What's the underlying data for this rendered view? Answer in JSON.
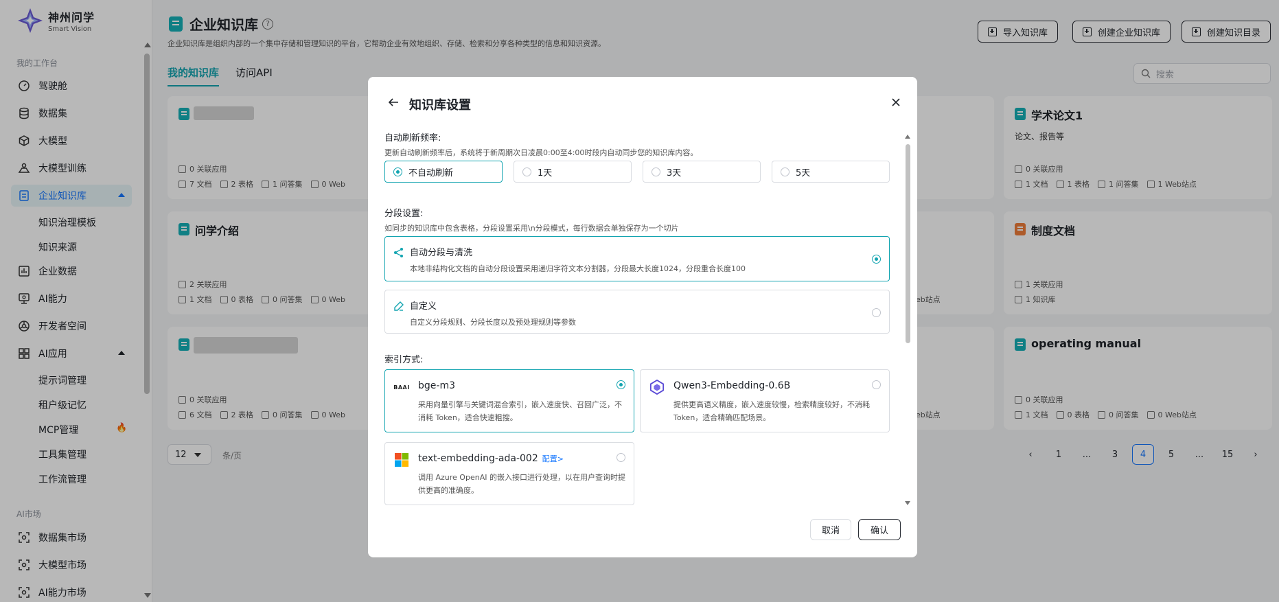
{
  "brand": {
    "name_cn": "神州问学",
    "name_en": "Smart Vision"
  },
  "sidebar": {
    "section_workbench": "我的工作台",
    "section_market": "AI市场",
    "items": [
      {
        "label": "驾驶舱",
        "icon": "dashboard-icon"
      },
      {
        "label": "数据集",
        "icon": "database-icon"
      },
      {
        "label": "大模型",
        "icon": "cube-icon"
      },
      {
        "label": "大模型训练",
        "icon": "training-icon"
      },
      {
        "label": "企业知识库",
        "icon": "knowledge-base-icon"
      },
      {
        "label": "企业数据",
        "icon": "bar-chart-icon"
      },
      {
        "label": "AI能力",
        "icon": "monitor-icon"
      },
      {
        "label": "开发者空间",
        "icon": "developer-icon"
      },
      {
        "label": "AI应用",
        "icon": "apps-grid-icon"
      },
      {
        "label": "数据集市场",
        "icon": "scan-icon"
      },
      {
        "label": "大模型市场",
        "icon": "scan-icon"
      },
      {
        "label": "AI能力市场",
        "icon": "scan-icon"
      }
    ],
    "kb_sub": [
      "知识治理模板",
      "知识来源"
    ],
    "app_sub": [
      "提示词管理",
      "租户级记忆",
      "MCP管理",
      "工具集管理",
      "工作流管理"
    ]
  },
  "header": {
    "title": "企业知识库",
    "desc": "企业知识库是组织内部的一个集中存储和管理知识的平台，它帮助企业有效地组织、存储、检索和分享各种类型的信息和知识资源。",
    "btn_import": "导入知识库",
    "btn_create": "创建企业知识库",
    "btn_catalog": "创建知识目录"
  },
  "tabs": [
    "我的知识库",
    "访问API"
  ],
  "search": {
    "placeholder": "搜索"
  },
  "cards": [
    {
      "title": "",
      "desc": "",
      "meta1": "0 关联应用",
      "docs": "7 文档",
      "tables": "2 表格",
      "qa": "1 问答集",
      "web": "0 Web"
    },
    {
      "title": "学术论文1",
      "desc": "论文、报告等",
      "meta1": "0 关联应用",
      "docs": "1 文档",
      "tables": "1 表格",
      "qa": "1 问答集",
      "web": "1 Web站点"
    },
    {
      "title": "问学介绍",
      "desc": "",
      "meta1": "2 关联应用",
      "docs": "1 文档",
      "tables": "0 表格",
      "qa": "0 问答集",
      "web": "0 Web"
    },
    {
      "title": "制度文档",
      "desc": "",
      "meta1": "1 关联应用",
      "kb": "1 知识库"
    },
    {
      "title": "",
      "desc": "",
      "meta1": "0 关联应用",
      "docs": "6 文档",
      "tables": "2 表格",
      "qa": "0 问答集",
      "web": "0 Web"
    },
    {
      "title": "operating manual",
      "desc": "",
      "meta1": "0 关联应用",
      "docs": "1 文档",
      "tables": "0 表格",
      "qa": "0 问答集",
      "web": "0 Web站点"
    }
  ],
  "partial_web": "eb站点",
  "pager": {
    "size": "12",
    "unit": "条/页",
    "pages": [
      "1",
      "...",
      "3",
      "4",
      "5",
      "...",
      "15"
    ],
    "current": "4"
  },
  "modal": {
    "title": "知识库设置",
    "freq_label": "自动刷新频率:",
    "freq_hint": "更新自动刷新频率后，系统将于新周期次日凌晨0:00至4:00时段内自动同步您的知识库内容。",
    "freq_options": [
      "不自动刷新",
      "1天",
      "3天",
      "5天"
    ],
    "freq_selected": "不自动刷新",
    "seg_label": "分段设置:",
    "seg_hint": "如同步的知识库中包含表格，分段设置采用\\n分段模式，每行数据会单独保存为一个切片",
    "seg_auto_title": "自动分段与清洗",
    "seg_auto_desc": "本地非结构化文档的自动分段设置采用递归字符文本分割器，分段最大长度1024，分段重合长度100",
    "seg_custom_title": "自定义",
    "seg_custom_desc": "自定义分段规则、分段长度以及预处理规则等参数",
    "index_label": "索引方式:",
    "embeddings": [
      {
        "name": "bge-m3",
        "logo_text": "BAAI",
        "desc": "采用向量引擎与关键词混合索引，嵌入速度快、召回广泛，不消耗 Token，适合快速粗搜。"
      },
      {
        "name": "Qwen3-Embedding-0.6B",
        "desc": "提供更高语义精度，嵌入速度较慢，检索精度较好，不消耗 Token，适合精确匹配场景。"
      },
      {
        "name": "text-embedding-ada-002",
        "config": "配置>",
        "desc": "调用 Azure OpenAI 的嵌入接口进行处理，以在用户查询时提供更高的准确度。"
      }
    ],
    "cancel": "取消",
    "ok": "确认"
  },
  "colors": {
    "accent": "#12a4b0",
    "link": "#1677ff",
    "hot": "#f5532d"
  }
}
